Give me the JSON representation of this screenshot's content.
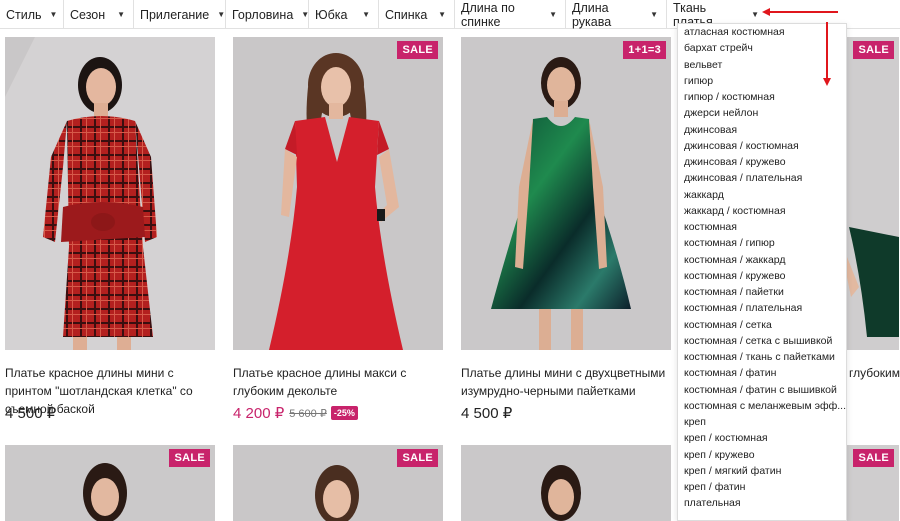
{
  "filters": [
    {
      "label": "Стиль"
    },
    {
      "label": "Сезон"
    },
    {
      "label": "Прилегание"
    },
    {
      "label": "Горловина"
    },
    {
      "label": "Юбка"
    },
    {
      "label": "Спинка"
    },
    {
      "label": "Длина по спинке"
    },
    {
      "label": "Длина рукава"
    },
    {
      "label": "Ткань платья"
    }
  ],
  "products": [
    {
      "title": "Платье красное длины мини с принтом \"шотландская клетка\" со съемной баской",
      "price": "4 500 ₽",
      "badge": ""
    },
    {
      "title": "Платье красное длины макси с глубоким декольте",
      "price": "4 200 ₽",
      "old_price": "5 600 ₽",
      "discount": "-25%",
      "badge": "SALE"
    },
    {
      "title": "Платье длины мини с двухцветными изумрудно-черными пайетками",
      "price": "4 500 ₽",
      "badge": "1+1=3"
    },
    {
      "title": "глубоким",
      "badge": "SALE"
    }
  ],
  "bottom_badges": [
    "SALE",
    "SALE",
    "SALE"
  ],
  "dropdown": {
    "options": [
      "атласная костюмная",
      "бархат стрейч",
      "вельвет",
      "гипюр",
      "гипюр / костюмная",
      "джерси нейлон",
      "джинсовая",
      "джинсовая / костюмная",
      "джинсовая / кружево",
      "джинсовая / плательная",
      "жаккард",
      "жаккард / костюмная",
      "костюмная",
      "костюмная / гипюр",
      "костюмная / жаккард",
      "костюмная / кружево",
      "костюмная / пайетки",
      "костюмная / плательная",
      "костюмная / сетка",
      "костюмная / сетка с вышивкой",
      "костюмная / ткань с пайетками",
      "костюмная / фатин",
      "костюмная / фатин с вышивкой",
      "костюмная с меланжевым эфф...",
      "креп",
      "креп / костюмная",
      "креп / кружево",
      "креп / мягкий фатин",
      "креп / фатин",
      "плательная"
    ]
  },
  "colors": {
    "accent": "#c8236b",
    "annotation": "#e0161c"
  }
}
